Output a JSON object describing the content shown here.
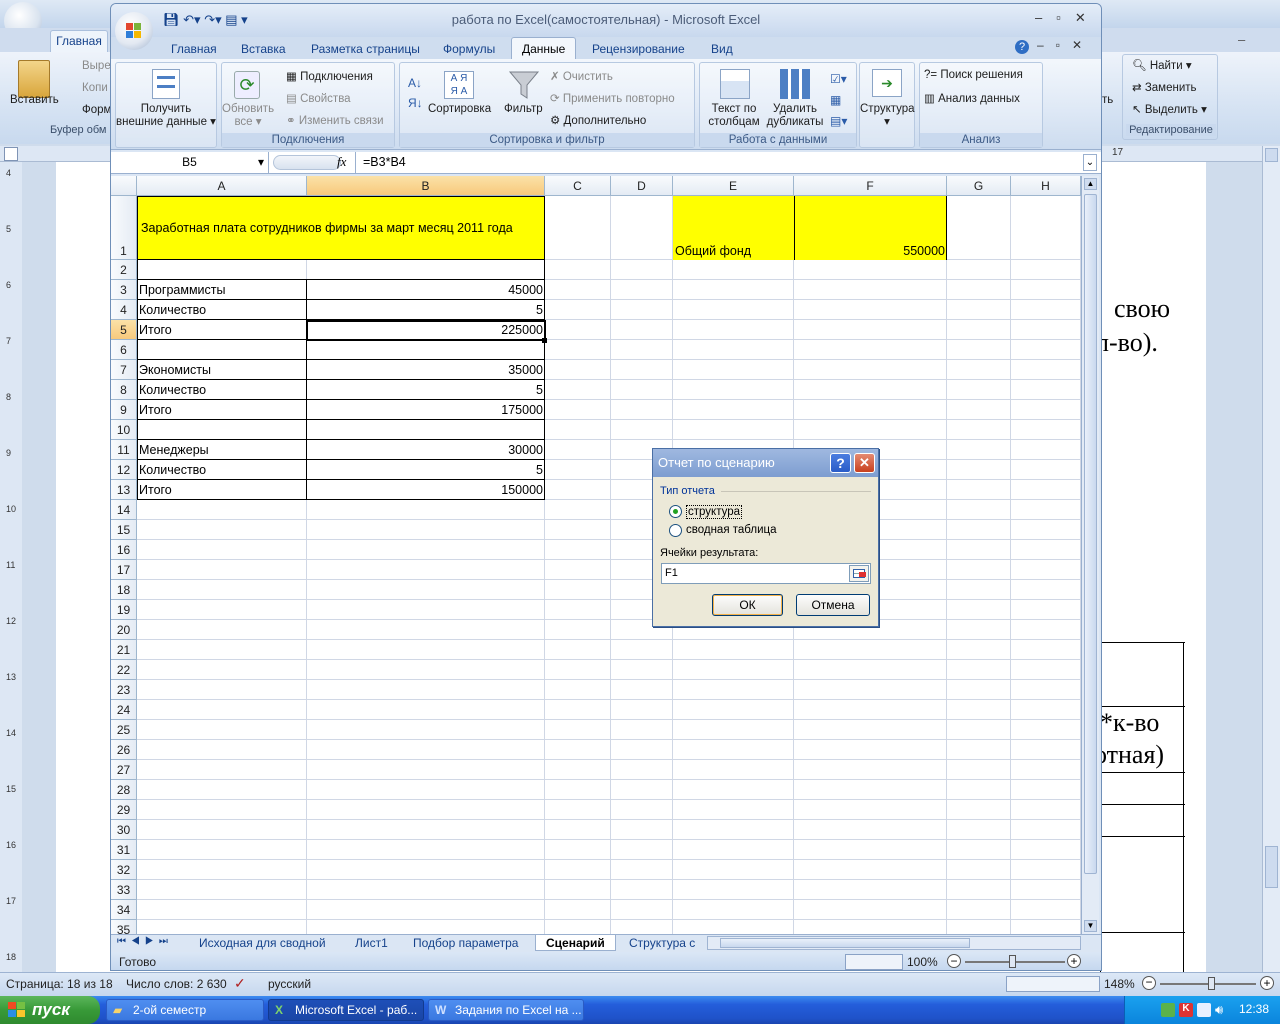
{
  "word": {
    "tab_home": "Главная",
    "clipboard": {
      "paste": "Вставить",
      "cut": "Выре",
      "copy": "Копи",
      "format": "Форм",
      "group": "Буфер обм"
    },
    "right_group": {
      "find": "Найти",
      "replace": "Заменить",
      "select": "Выделить",
      "group": "Редактирование",
      "partial": "ть"
    },
    "ruler_num": "17",
    "vruler_nums": [
      "4",
      "5",
      "6",
      "7",
      "8",
      "9",
      "10",
      "11",
      "12",
      "13",
      "14",
      "15",
      "16",
      "17",
      "18"
    ],
    "doc_lines": [
      "свою",
      "л-во).",
      "*к-во",
      "отная)"
    ],
    "status": {
      "page": "Страница: 18 из 18",
      "words": "Число слов: 2 630",
      "lang": "русский",
      "zoom": "148%"
    }
  },
  "excel": {
    "window_title": "работа по Excel(самостоятельная) - Microsoft Excel",
    "tabs": [
      "Главная",
      "Вставка",
      "Разметка страницы",
      "Формулы",
      "Данные",
      "Рецензирование",
      "Вид"
    ],
    "active_tab": "Данные",
    "ribbon": {
      "get_external": [
        "Получить",
        "внешние данные"
      ],
      "refresh_all": [
        "Обновить",
        "все"
      ],
      "connections": "Подключения",
      "properties": "Свойства",
      "edit_links": "Изменить связи",
      "group_connections": "Подключения",
      "sort": "Сортировка",
      "filter": "Фильтр",
      "clear": "Очистить",
      "reapply": "Применить повторно",
      "advanced": "Дополнительно",
      "group_sort": "Сортировка и фильтр",
      "text_to_cols": [
        "Текст по",
        "столбцам"
      ],
      "remove_dups": [
        "Удалить",
        "дубликаты"
      ],
      "group_data": "Работа с данными",
      "outline": "Структура",
      "solver": "Поиск решения",
      "analysis": "Анализ данных",
      "group_analysis": "Анализ"
    },
    "name_box": "B5",
    "fx": "fx",
    "formula": "=B3*B4",
    "columns": [
      "A",
      "B",
      "C",
      "D",
      "E",
      "F",
      "G",
      "H"
    ],
    "rows": [
      "1",
      "2",
      "3",
      "4",
      "5",
      "6",
      "7",
      "8",
      "9",
      "10",
      "11",
      "12",
      "13",
      "14",
      "15",
      "16",
      "17",
      "18",
      "19",
      "20",
      "21",
      "22",
      "23",
      "24",
      "25",
      "26",
      "27",
      "28",
      "29",
      "30",
      "31",
      "32",
      "33",
      "34",
      "35"
    ],
    "cells": {
      "A1": "Заработная плата сотрудников фирмы за март месяц 2011 года",
      "E1": "Общий фонд",
      "F1": "550000",
      "A3": "Программисты",
      "B3": "45000",
      "A4": "Количество",
      "B4": "5",
      "A5": "Итого",
      "B5": "225000",
      "A7": "Экономисты",
      "B7": "35000",
      "A8": "Количество",
      "B8": "5",
      "A9": "Итого",
      "B9": "175000",
      "A11": "Менеджеры",
      "B11": "30000",
      "A12": "Количество",
      "B12": "5",
      "A13": "Итого",
      "B13": "150000"
    },
    "sheet_tabs": [
      "Исходная для сводной",
      "Лист1",
      "Подбор параметра",
      "Сценарий",
      "Структура с"
    ],
    "active_sheet": "Сценарий",
    "status": {
      "ready": "Готово",
      "zoom": "100%"
    }
  },
  "dialog": {
    "title": "Отчет по сценарию",
    "help": "?",
    "group": "Тип отчета",
    "option1": "структура",
    "option2": "сводная таблица",
    "selected": "структура",
    "result_label": "Ячейки результата:",
    "result_value": "F1",
    "ok": "ОК",
    "cancel": "Отмена"
  },
  "taskbar": {
    "start": "пуск",
    "items": [
      "2-ой семестр",
      "Microsoft Excel - раб...",
      "Задания по Excel на ..."
    ],
    "lang": "RU",
    "clock": "12:38"
  },
  "colors": {
    "yellow": "#ffff00",
    "selected_header": "#f8c97c",
    "taskbar": "#245edb",
    "start": "#389a38"
  }
}
